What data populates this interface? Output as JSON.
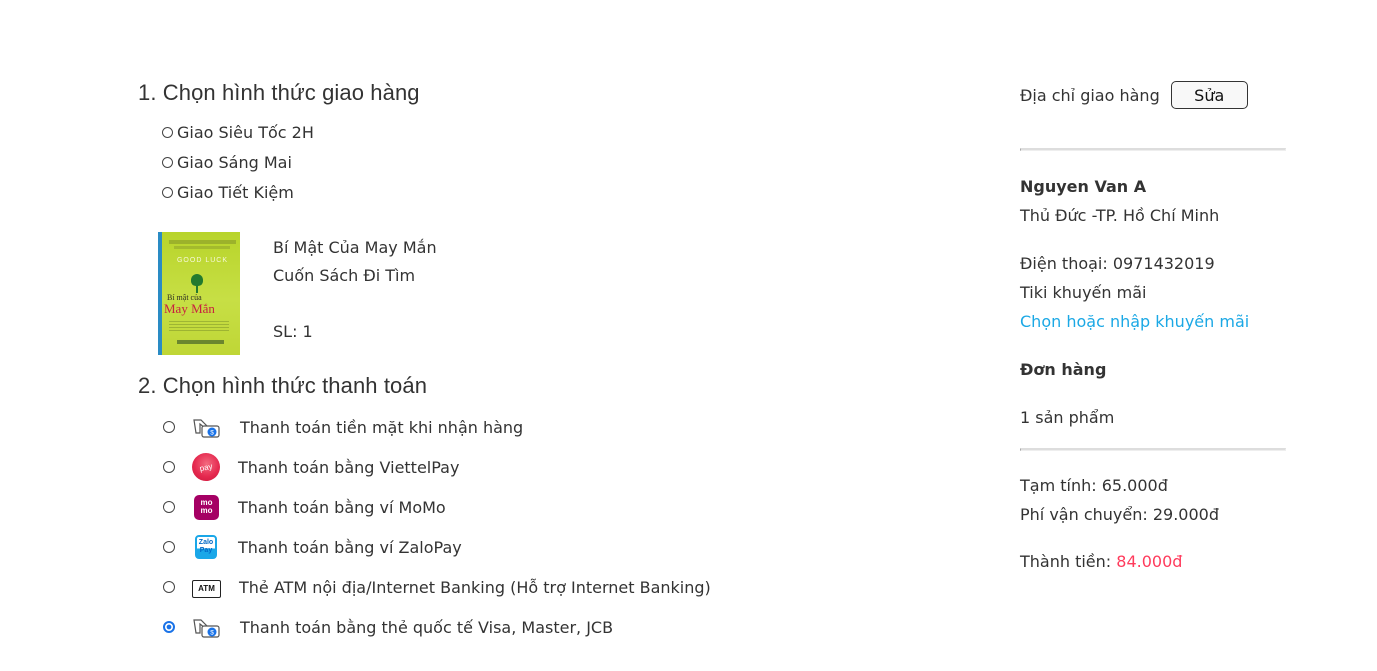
{
  "shipping": {
    "title": "1. Chọn hình thức giao hàng",
    "options": [
      {
        "label": "Giao Siêu Tốc 2H",
        "selected": false
      },
      {
        "label": "Giao Sáng Mai",
        "selected": false
      },
      {
        "label": "Giao Tiết Kiệm",
        "selected": false
      }
    ]
  },
  "product": {
    "name_line_1": "Bí Mật Của May Mắn",
    "name_line_2": "Cuốn Sách Đi Tìm",
    "quantity_label": "SL: 1",
    "cover_text": {
      "good_luck": "GOOD LUCK",
      "title_small": "Bí mật của",
      "title_large": "May Mắn"
    }
  },
  "payment": {
    "title": "2. Chọn hình thức thanh toán",
    "options": [
      {
        "label": "Thanh toán tiền mặt khi nhận hàng",
        "icon": "cash-hand-icon",
        "selected": false
      },
      {
        "label": "Thanh toán bằng ViettelPay",
        "icon": "viettelpay-icon",
        "selected": false,
        "icon_text": "pay"
      },
      {
        "label": "Thanh toán bằng ví MoMo",
        "icon": "momo-icon",
        "selected": false,
        "icon_text": "mo mo"
      },
      {
        "label": "Thanh toán bằng ví ZaloPay",
        "icon": "zalopay-icon",
        "selected": false,
        "icon_text": "Zalo Pay"
      },
      {
        "label": "Thẻ ATM nội địa/Internet Banking (Hỗ trợ Internet Banking)",
        "icon": "atm-icon",
        "selected": false,
        "icon_text": "ATM"
      },
      {
        "label": "Thanh toán bằng thẻ quốc tế Visa, Master, JCB",
        "icon": "card-hand-icon",
        "selected": true
      }
    ]
  },
  "summary": {
    "address_label": "Địa chỉ giao hàng",
    "edit_button": "Sửa",
    "customer_name": "Nguyen Van A",
    "city": "Thủ Đức -TP. Hồ Chí Minh",
    "phone": "Điện thoại: 0971432019",
    "promo_label": "Tiki khuyến mãi",
    "promo_link": "Chọn hoặc nhập khuyến mãi",
    "orders_title": "Đơn hàng",
    "product_count": "1 sản phẩm",
    "subtotal": "Tạm tính: 65.000đ",
    "shipping_fee": "Phí vận chuyển: 29.000đ",
    "total_label": "Thành tiền: ",
    "total_value": "84.000đ"
  },
  "colors": {
    "link": "#1ba8e5",
    "total": "#ff3b5c",
    "radio_selected": "#1a73e8",
    "viettelpay": "#e5294f",
    "momo": "#a50064",
    "zalopay": "#1aa7e8"
  }
}
